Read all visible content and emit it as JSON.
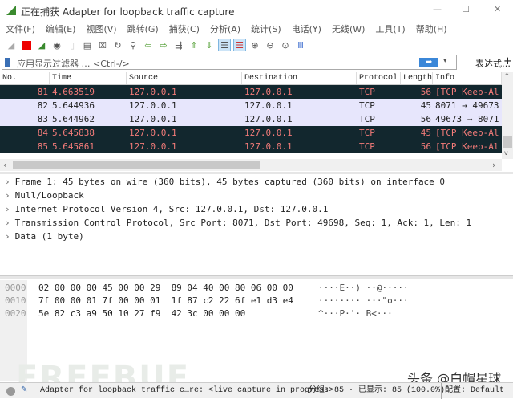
{
  "window": {
    "title": "正在捕获 Adapter for loopback traffic capture",
    "minimize": "—",
    "maximize": "☐",
    "close": "✕"
  },
  "menu": [
    "文件(F)",
    "编辑(E)",
    "视图(V)",
    "跳转(G)",
    "捕获(C)",
    "分析(A)",
    "统计(S)",
    "电话(Y)",
    "无线(W)",
    "工具(T)",
    "帮助(H)"
  ],
  "filter": {
    "placeholder": "应用显示过滤器 … <Ctrl-/>",
    "apply": "➡",
    "dropdown": "▾",
    "expression": "表达式…",
    "add": "+"
  },
  "columns": [
    "No.",
    "Time",
    "Source",
    "Destination",
    "Protocol",
    "Length",
    "Info"
  ],
  "packets": [
    {
      "no": "81",
      "time": "4.663519",
      "src": "127.0.0.1",
      "dst": "127.0.0.1",
      "proto": "TCP",
      "len": "56",
      "info": "[TCP Keep-Al",
      "style": "dark"
    },
    {
      "no": "82",
      "time": "5.644936",
      "src": "127.0.0.1",
      "dst": "127.0.0.1",
      "proto": "TCP",
      "len": "45",
      "info": "8071 → 49673",
      "style": "light"
    },
    {
      "no": "83",
      "time": "5.644962",
      "src": "127.0.0.1",
      "dst": "127.0.0.1",
      "proto": "TCP",
      "len": "56",
      "info": "49673 → 8071",
      "style": "light"
    },
    {
      "no": "84",
      "time": "5.645838",
      "src": "127.0.0.1",
      "dst": "127.0.0.1",
      "proto": "TCP",
      "len": "45",
      "info": "[TCP Keep-Al",
      "style": "dark"
    },
    {
      "no": "85",
      "time": "5.645861",
      "src": "127.0.0.1",
      "dst": "127.0.0.1",
      "proto": "TCP",
      "len": "56",
      "info": "[TCP Keep-Al",
      "style": "dark"
    }
  ],
  "details": [
    "Frame 1: 45 bytes on wire (360 bits), 45 bytes captured (360 bits) on interface 0",
    "Null/Loopback",
    "Internet Protocol Version 4, Src: 127.0.0.1, Dst: 127.0.0.1",
    "Transmission Control Protocol, Src Port: 8071, Dst Port: 49698, Seq: 1, Ack: 1, Len: 1",
    "Data (1 byte)"
  ],
  "bytes": [
    {
      "offset": "0000",
      "hex": "02 00 00 00 45 00 00 29  89 04 40 00 80 06 00 00",
      "ascii": "····E··) ··@·····"
    },
    {
      "offset": "0010",
      "hex": "7f 00 00 01 7f 00 00 01  1f 87 c2 22 6f e1 d3 e4",
      "ascii": "········ ···\"o···"
    },
    {
      "offset": "0020",
      "hex": "5e 82 c3 a9 50 10 27 f9  42 3c 00 00 00",
      "ascii": "^···P·'· B<···"
    }
  ],
  "status": {
    "capture": "Adapter for loopback traffic c…re: <live capture in progress>",
    "packets": "分组: 85 · 已显示: 85 (100.0%)",
    "profile": "配置: Default"
  },
  "watermark": {
    "logo": "FREEBUF",
    "credit": "头条 @白帽星球"
  },
  "colors": {
    "dark_row_bg": "#12272e",
    "dark_row_fg": "#f37b79",
    "light_row_bg": "#e7e6fc"
  }
}
